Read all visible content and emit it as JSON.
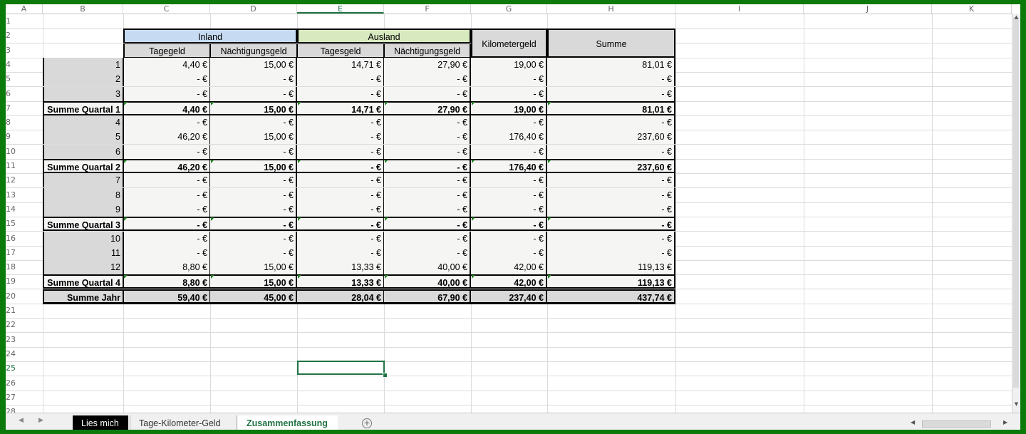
{
  "columns": [
    "A",
    "B",
    "C",
    "D",
    "E",
    "F",
    "G",
    "H",
    "I",
    "J",
    "K"
  ],
  "rows": [
    "1",
    "2",
    "3",
    "4",
    "5",
    "6",
    "7",
    "8",
    "9",
    "10",
    "11",
    "12",
    "13",
    "14",
    "15",
    "16",
    "17",
    "18",
    "19",
    "20",
    "21",
    "22",
    "23",
    "24",
    "25",
    "26",
    "27",
    "28"
  ],
  "active_column": "E",
  "active_row": "25",
  "headers": {
    "inland": "Inland",
    "ausland": "Ausland",
    "kilometergeld": "Kilometergeld",
    "summe": "Summe",
    "tagegeld": "Tagegeld",
    "naechtigungsgeld_inland": "Nächtigungsgeld",
    "tagesgeld": "Tagesgeld",
    "naechtigungsgeld_ausland": "Nächtigungsgeld"
  },
  "table_rows": [
    {
      "label": "1",
      "values": [
        "4,40 €",
        "15,00 €",
        "14,71 €",
        "27,90 €",
        "19,00 €",
        "81,01 €"
      ],
      "type": "month"
    },
    {
      "label": "2",
      "values": [
        "-   €",
        "-   €",
        "-   €",
        "-   €",
        "-   €",
        "-   €"
      ],
      "type": "month"
    },
    {
      "label": "3",
      "values": [
        "-   €",
        "-   €",
        "-   €",
        "-   €",
        "-   €",
        "-   €"
      ],
      "type": "month"
    },
    {
      "label": "Summe Quartal 1",
      "values": [
        "4,40 €",
        "15,00 €",
        "14,71 €",
        "27,90 €",
        "19,00 €",
        "81,01 €"
      ],
      "type": "sum"
    },
    {
      "label": "4",
      "values": [
        "-   €",
        "-   €",
        "-   €",
        "-   €",
        "-   €",
        "-   €"
      ],
      "type": "month"
    },
    {
      "label": "5",
      "values": [
        "46,20 €",
        "15,00 €",
        "-   €",
        "-   €",
        "176,40 €",
        "237,60 €"
      ],
      "type": "month"
    },
    {
      "label": "6",
      "values": [
        "-   €",
        "-   €",
        "-   €",
        "-   €",
        "-   €",
        "-   €"
      ],
      "type": "month"
    },
    {
      "label": "Summe Quartal 2",
      "values": [
        "46,20 €",
        "15,00 €",
        "-   €",
        "-   €",
        "176,40 €",
        "237,60 €"
      ],
      "type": "sum"
    },
    {
      "label": "7",
      "values": [
        "-   €",
        "-   €",
        "-   €",
        "-   €",
        "-   €",
        "-   €"
      ],
      "type": "month"
    },
    {
      "label": "8",
      "values": [
        "-   €",
        "-   €",
        "-   €",
        "-   €",
        "-   €",
        "-   €"
      ],
      "type": "month"
    },
    {
      "label": "9",
      "values": [
        "-   €",
        "-   €",
        "-   €",
        "-   €",
        "-   €",
        "-   €"
      ],
      "type": "month"
    },
    {
      "label": "Summe Quartal 3",
      "values": [
        "-   €",
        "-   €",
        "-   €",
        "-   €",
        "-   €",
        "-   €"
      ],
      "type": "sum"
    },
    {
      "label": "10",
      "values": [
        "-   €",
        "-   €",
        "-   €",
        "-   €",
        "-   €",
        "-   €"
      ],
      "type": "month"
    },
    {
      "label": "11",
      "values": [
        "-   €",
        "-   €",
        "-   €",
        "-   €",
        "-   €",
        "-   €"
      ],
      "type": "month"
    },
    {
      "label": "12",
      "values": [
        "8,80 €",
        "15,00 €",
        "13,33 €",
        "40,00 €",
        "42,00 €",
        "119,13 €"
      ],
      "type": "month"
    },
    {
      "label": "Summe Quartal 4",
      "values": [
        "8,80 €",
        "15,00 €",
        "13,33 €",
        "40,00 €",
        "42,00 €",
        "119,13 €"
      ],
      "type": "sum"
    },
    {
      "label": "Summe Jahr",
      "values": [
        "59,40 €",
        "45,00 €",
        "28,04 €",
        "67,90 €",
        "237,40 €",
        "437,74 €"
      ],
      "type": "year"
    }
  ],
  "sheet_tabs": [
    {
      "label": "Lies mich",
      "state": "dark"
    },
    {
      "label": "Tage-Kilometer-Geld",
      "state": "normal"
    },
    {
      "label": "Zusammenfassung",
      "state": "active"
    }
  ],
  "colors": {
    "frame": "#0b7a0b",
    "accent": "#217346",
    "inland": "#c6dbf2",
    "ausland": "#d8e9c0",
    "label_grey": "#d9d9d9"
  }
}
